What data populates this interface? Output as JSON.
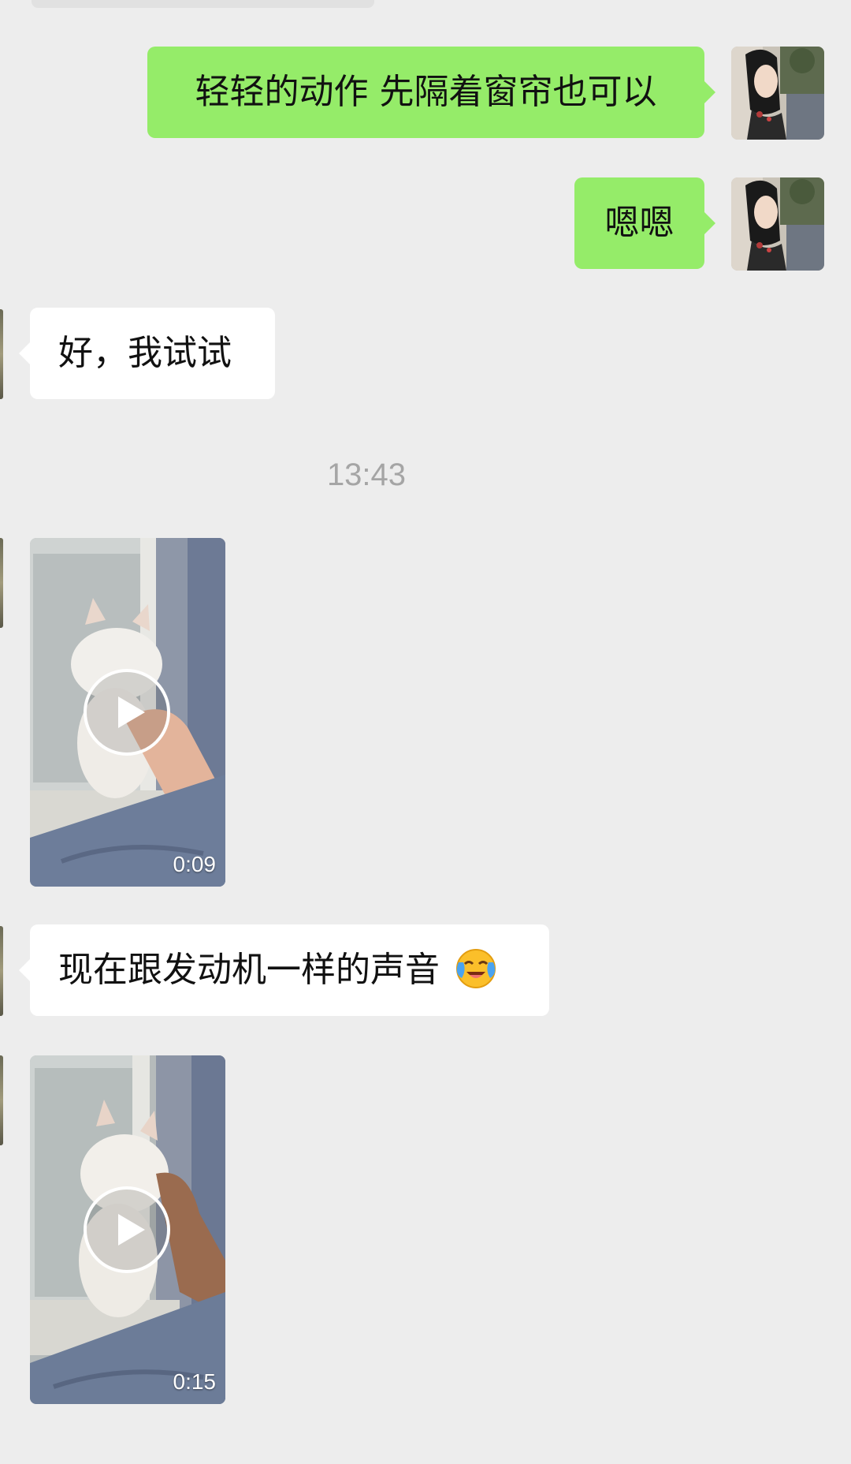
{
  "messages": [
    {
      "side": "out",
      "type": "text",
      "text": "轻轻的动作 先隔着窗帘也可以"
    },
    {
      "side": "out",
      "type": "text",
      "text": "嗯嗯"
    },
    {
      "side": "in",
      "type": "text",
      "text": "好，我试试"
    },
    {
      "type": "timestamp",
      "text": "13:43"
    },
    {
      "side": "in",
      "type": "video",
      "duration": "0:09"
    },
    {
      "side": "in",
      "type": "text",
      "text": "现在跟发动机一样的声音",
      "emoji": "face-with-tears-of-joy"
    },
    {
      "side": "in",
      "type": "video",
      "duration": "0:15"
    }
  ],
  "colors": {
    "background": "#ededed",
    "outgoing_bubble": "#95ec69",
    "incoming_bubble": "#ffffff",
    "timestamp_text": "#a5a5a5"
  }
}
